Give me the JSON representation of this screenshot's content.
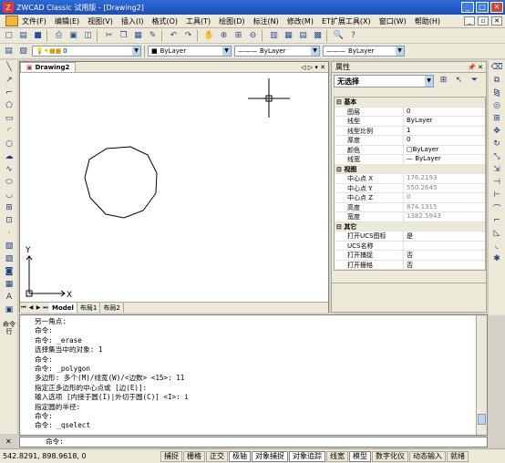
{
  "window": {
    "title": "ZWCAD Classic 试用版 - [Drawing2]"
  },
  "menu": [
    "文件(F)",
    "编辑(E)",
    "视图(V)",
    "插入(I)",
    "格式(O)",
    "工具(T)",
    "绘图(D)",
    "标注(N)",
    "修改(M)",
    "ET扩展工具(X)",
    "窗口(W)",
    "帮助(H)"
  ],
  "layers": {
    "layer_value": "0",
    "color_value": "ByLayer",
    "linetype_value": "ByLayer",
    "lineweight_value": "ByLayer"
  },
  "document": {
    "tab_label": "Drawing2"
  },
  "layout_tabs": [
    "Model",
    "布局1",
    "布局2"
  ],
  "axis": {
    "x_label": "X",
    "y_label": "Y"
  },
  "properties": {
    "title": "属性",
    "selection": "无选择",
    "sections": [
      {
        "name": "基本",
        "rows": [
          {
            "key": "图层",
            "value": "0"
          },
          {
            "key": "线型",
            "value": "ByLayer"
          },
          {
            "key": "线型比例",
            "value": "1"
          },
          {
            "key": "厚度",
            "value": "0"
          },
          {
            "key": "颜色",
            "value": "ByLayer"
          },
          {
            "key": "线宽",
            "value": "ByLayer"
          }
        ]
      },
      {
        "name": "视图",
        "rows": [
          {
            "key": "中心点 X",
            "value": "176.2193"
          },
          {
            "key": "中心点 Y",
            "value": "550.2645"
          },
          {
            "key": "中心点 Z",
            "value": "0"
          },
          {
            "key": "高度",
            "value": "874.1315"
          },
          {
            "key": "宽度",
            "value": "1382.5943"
          }
        ]
      },
      {
        "name": "其它",
        "rows": [
          {
            "key": "打开UCS图标",
            "value": "是"
          },
          {
            "key": "UCS名称",
            "value": ""
          },
          {
            "key": "打开捕捉",
            "value": "否"
          },
          {
            "key": "打开栅格",
            "value": "否"
          }
        ]
      }
    ]
  },
  "command": {
    "handle_label": "命令行",
    "lines": [
      "另一角点:",
      "命令:",
      "命令: _erase",
      "选择集当中的对象: 1",
      "命令:",
      "命令: _polygon",
      "多边形:  多个(M)/线宽(W)/<边数> <15>: 11",
      "指定正多边形的中心点或 [边(E)]:",
      "输入选项 [内接于圆(I)|外切于圆(C)] <I>: i",
      "指定圆的半径:",
      "命令:",
      "命令: _qselect"
    ],
    "prompt": "命令:"
  },
  "status": {
    "coords": "542.8291, 898.9618, 0",
    "toggles": [
      "捕捉",
      "栅格",
      "正交",
      "极轴",
      "对象捕捉",
      "对象追踪",
      "线宽",
      "模型",
      "数字化仪",
      "动态输入",
      "就绪"
    ]
  }
}
